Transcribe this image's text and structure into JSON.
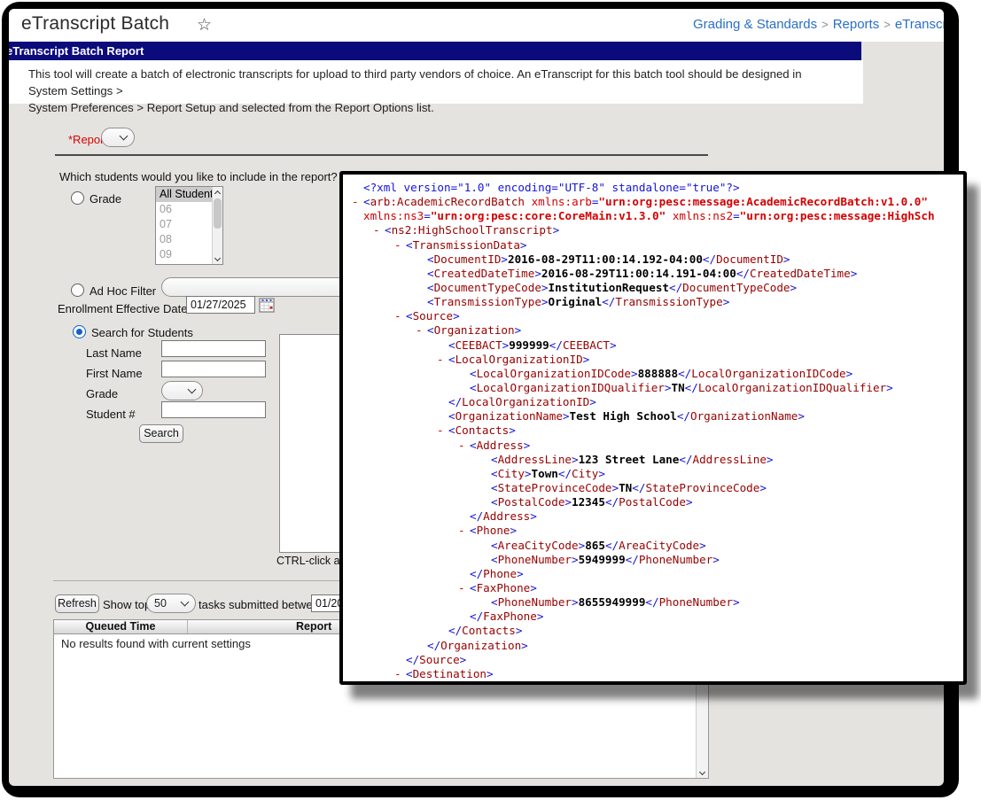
{
  "colors": {
    "title_bar_bg": "#0b0b7c",
    "breadcrumb_link": "#2a6fc9",
    "required_field_red": "#dd0000",
    "xml_element_name": "#990000",
    "xml_bracket_blue": "#1414d4",
    "xml_attr_value_red": "#d40000"
  },
  "header": {
    "title": "eTranscript Batch",
    "star_icon": "☆",
    "breadcrumb": {
      "items": [
        "Grading & Standards",
        "Reports",
        "eTranscript Batch"
      ],
      "separator": ">"
    }
  },
  "banner": {
    "title": "eTranscript Batch Report"
  },
  "intro": {
    "line1": "This tool will create a batch of electronic transcripts for upload to third party vendors of choice.   An eTranscript for this batch tool should be designed in System Settings >",
    "line2": "System Preferences > Report Setup and selected from the Report Options list."
  },
  "form": {
    "report_label": "*Report",
    "report_value": "",
    "student_question": "Which students would you like to include in the report?",
    "grade": {
      "label": "Grade",
      "options": [
        "All Students",
        "06",
        "07",
        "08",
        "09"
      ],
      "selected": "All Students"
    },
    "ad_hoc": {
      "label": "Ad Hoc Filter",
      "value": ""
    },
    "enrollment": {
      "label": "Enrollment Effective Date",
      "value": "01/27/2025"
    },
    "search_students": {
      "label": "Search for Students",
      "last_name_label": "Last Name",
      "last_name_value": "",
      "first_name_label": "First Name",
      "first_name_value": "",
      "grade_label": "Grade",
      "grade_value": "",
      "student_number_label": "Student #",
      "student_number_value": "",
      "search_button": "Search"
    },
    "multiselect_hint": "CTRL-click and"
  },
  "queue": {
    "refresh_button": "Refresh",
    "show_top_label": "Show top",
    "show_top_value": "50",
    "between_label": "tasks submitted between",
    "from_date": "01/20",
    "columns": [
      "Queued Time",
      "Report"
    ],
    "empty_message": "No results found with current settings"
  },
  "xml_viewer": {
    "lines": [
      {
        "type": "prolog",
        "lvl": 0,
        "content": "<?xml version=\"1.0\" encoding=\"UTF-8\" standalone=\"true\"?>"
      },
      {
        "type": "root-open",
        "lvl": 0,
        "marker": true,
        "tag": "arb:AcademicRecordBatch",
        "attrs": [
          {
            "n": "xmlns:arb",
            "v": "urn:org:pesc:message:AcademicRecordBatch:v1.0.0",
            "closed": true
          }
        ]
      },
      {
        "type": "attrs",
        "lvl": 0,
        "attrs": [
          {
            "n": "xmlns:ns3",
            "v": "urn:org:pesc:core:CoreMain:v1.3.0",
            "closed": true
          },
          {
            "n": "xmlns:ns2",
            "v": "urn:org:pesc:message:HighSch",
            "closed": false
          }
        ]
      },
      {
        "type": "open",
        "lvl": 1,
        "marker": true,
        "tag": "ns2:HighSchoolTranscript"
      },
      {
        "type": "open",
        "lvl": 2,
        "marker": true,
        "tag": "TransmissionData"
      },
      {
        "type": "leaf",
        "lvl": 3,
        "tag": "DocumentID",
        "value": "2016-08-29T11:00:14.192-04:00"
      },
      {
        "type": "leaf",
        "lvl": 3,
        "tag": "CreatedDateTime",
        "value": "2016-08-29T11:00:14.191-04:00"
      },
      {
        "type": "leaf",
        "lvl": 3,
        "tag": "DocumentTypeCode",
        "value": "InstitutionRequest"
      },
      {
        "type": "leaf",
        "lvl": 3,
        "tag": "TransmissionType",
        "value": "Original"
      },
      {
        "type": "open",
        "lvl": 2,
        "marker": true,
        "tag": "Source"
      },
      {
        "type": "open",
        "lvl": 3,
        "marker": true,
        "tag": "Organization"
      },
      {
        "type": "leaf",
        "lvl": 4,
        "tag": "CEEBACT",
        "value": "999999"
      },
      {
        "type": "open",
        "lvl": 4,
        "marker": true,
        "tag": "LocalOrganizationID"
      },
      {
        "type": "leaf",
        "lvl": 5,
        "tag": "LocalOrganizationIDCode",
        "value": "888888"
      },
      {
        "type": "leaf",
        "lvl": 5,
        "tag": "LocalOrganizationIDQualifier",
        "value": "TN"
      },
      {
        "type": "close",
        "lvl": 4,
        "tag": "LocalOrganizationID"
      },
      {
        "type": "leaf",
        "lvl": 4,
        "tag": "OrganizationName",
        "value": "Test High School"
      },
      {
        "type": "open",
        "lvl": 4,
        "marker": true,
        "tag": "Contacts"
      },
      {
        "type": "open",
        "lvl": 5,
        "marker": true,
        "tag": "Address"
      },
      {
        "type": "leaf",
        "lvl": 6,
        "tag": "AddressLine",
        "value": "123 Street Lane"
      },
      {
        "type": "leaf",
        "lvl": 6,
        "tag": "City",
        "value": "Town"
      },
      {
        "type": "leaf",
        "lvl": 6,
        "tag": "StateProvinceCode",
        "value": "TN"
      },
      {
        "type": "leaf",
        "lvl": 6,
        "tag": "PostalCode",
        "value": "12345"
      },
      {
        "type": "close",
        "lvl": 5,
        "tag": "Address"
      },
      {
        "type": "open",
        "lvl": 5,
        "marker": true,
        "tag": "Phone"
      },
      {
        "type": "leaf",
        "lvl": 6,
        "tag": "AreaCityCode",
        "value": "865"
      },
      {
        "type": "leaf",
        "lvl": 6,
        "tag": "PhoneNumber",
        "value": "5949999"
      },
      {
        "type": "close",
        "lvl": 5,
        "tag": "Phone"
      },
      {
        "type": "open",
        "lvl": 5,
        "marker": true,
        "tag": "FaxPhone"
      },
      {
        "type": "leaf",
        "lvl": 6,
        "tag": "PhoneNumber",
        "value": "8655949999"
      },
      {
        "type": "close",
        "lvl": 5,
        "tag": "FaxPhone"
      },
      {
        "type": "close",
        "lvl": 4,
        "tag": "Contacts"
      },
      {
        "type": "close",
        "lvl": 3,
        "tag": "Organization"
      },
      {
        "type": "close",
        "lvl": 2,
        "tag": "Source"
      },
      {
        "type": "open",
        "lvl": 2,
        "marker": true,
        "tag": "Destination"
      }
    ]
  }
}
